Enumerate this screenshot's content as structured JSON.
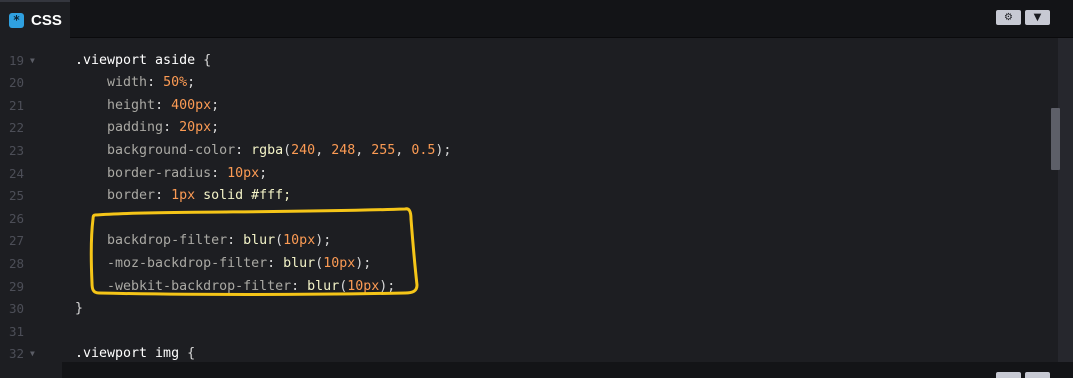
{
  "header": {
    "tab_label": "CSS",
    "tab_icon": "css-icon",
    "settings_icon": "gear-icon",
    "collapse_icon": "chevron-down-icon"
  },
  "editor": {
    "lines": [
      {
        "num": "",
        "fold": "",
        "tokens": []
      },
      {
        "num": "19",
        "fold": "▼",
        "tokens": [
          {
            "t": ".viewport aside",
            "c": "sel"
          },
          {
            "t": " {",
            "c": "p"
          }
        ]
      },
      {
        "num": "20",
        "fold": "",
        "tokens": [
          {
            "t": "    width",
            "c": "pr"
          },
          {
            "t": ": ",
            "c": "p"
          },
          {
            "t": "50%",
            "c": "v"
          },
          {
            "t": ";",
            "c": "p"
          }
        ]
      },
      {
        "num": "21",
        "fold": "",
        "tokens": [
          {
            "t": "    height",
            "c": "pr"
          },
          {
            "t": ": ",
            "c": "p"
          },
          {
            "t": "400px",
            "c": "v"
          },
          {
            "t": ";",
            "c": "p"
          }
        ]
      },
      {
        "num": "22",
        "fold": "",
        "tokens": [
          {
            "t": "    padding",
            "c": "pr"
          },
          {
            "t": ": ",
            "c": "p"
          },
          {
            "t": "20px",
            "c": "v"
          },
          {
            "t": ";",
            "c": "p"
          }
        ]
      },
      {
        "num": "23",
        "fold": "",
        "tokens": [
          {
            "t": "    background-color",
            "c": "pr"
          },
          {
            "t": ": ",
            "c": "p"
          },
          {
            "t": "rgba",
            "c": "fn"
          },
          {
            "t": "(",
            "c": "p"
          },
          {
            "t": "240",
            "c": "v"
          },
          {
            "t": ", ",
            "c": "p"
          },
          {
            "t": "248",
            "c": "v"
          },
          {
            "t": ", ",
            "c": "p"
          },
          {
            "t": "255",
            "c": "v"
          },
          {
            "t": ", ",
            "c": "p"
          },
          {
            "t": "0.5",
            "c": "v"
          },
          {
            "t": ");",
            "c": "p"
          }
        ]
      },
      {
        "num": "24",
        "fold": "",
        "tokens": [
          {
            "t": "    border-radius",
            "c": "pr"
          },
          {
            "t": ": ",
            "c": "p"
          },
          {
            "t": "10px",
            "c": "v"
          },
          {
            "t": ";",
            "c": "p"
          }
        ]
      },
      {
        "num": "25",
        "fold": "",
        "tokens": [
          {
            "t": "    border",
            "c": "pr"
          },
          {
            "t": ": ",
            "c": "p"
          },
          {
            "t": "1px",
            "c": "v"
          },
          {
            "t": " solid #fff;",
            "c": "fn"
          }
        ]
      },
      {
        "num": "26",
        "fold": "",
        "tokens": []
      },
      {
        "num": "27",
        "fold": "",
        "tokens": [
          {
            "t": "    backdrop-filter",
            "c": "pr"
          },
          {
            "t": ": ",
            "c": "p"
          },
          {
            "t": "blur",
            "c": "fn"
          },
          {
            "t": "(",
            "c": "p"
          },
          {
            "t": "10px",
            "c": "v"
          },
          {
            "t": ");",
            "c": "p"
          }
        ]
      },
      {
        "num": "28",
        "fold": "",
        "tokens": [
          {
            "t": "    -moz-backdrop-filter",
            "c": "pr"
          },
          {
            "t": ": ",
            "c": "p"
          },
          {
            "t": "blur",
            "c": "fn"
          },
          {
            "t": "(",
            "c": "p"
          },
          {
            "t": "10px",
            "c": "v"
          },
          {
            "t": ");",
            "c": "p"
          }
        ]
      },
      {
        "num": "29",
        "fold": "",
        "tokens": [
          {
            "t": "    -webkit-backdrop-filter",
            "c": "pr"
          },
          {
            "t": ": ",
            "c": "p"
          },
          {
            "t": "blur",
            "c": "fn"
          },
          {
            "t": "(",
            "c": "p"
          },
          {
            "t": "10px",
            "c": "v"
          },
          {
            "t": ");",
            "c": "p"
          }
        ]
      },
      {
        "num": "30",
        "fold": "",
        "tokens": [
          {
            "t": "}",
            "c": "p"
          }
        ]
      },
      {
        "num": "31",
        "fold": "",
        "tokens": []
      },
      {
        "num": "32",
        "fold": "▼",
        "tokens": [
          {
            "t": ".viewport img",
            "c": "sel"
          },
          {
            "t": " {",
            "c": "p"
          }
        ]
      }
    ]
  },
  "colors": {
    "background": "#1d1e22",
    "header": "#131417",
    "selector": "#ffffff",
    "property": "#aaa9a4",
    "value": "#fc9b54",
    "function": "#f3f3c7",
    "highlight_marker": "#f5c518"
  }
}
